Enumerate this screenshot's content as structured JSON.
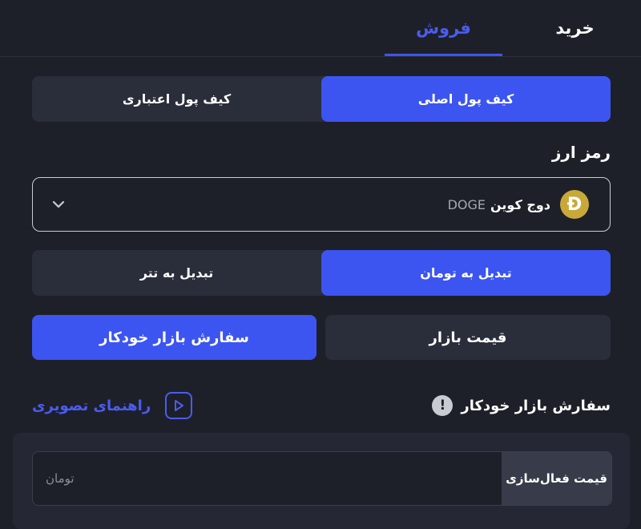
{
  "tabs": {
    "buy": "خرید",
    "sell": "فروش"
  },
  "wallet": {
    "main": "کیف پول اصلی",
    "credit": "کیف پول اعتباری"
  },
  "crypto": {
    "label": "رمز ارز",
    "selected_name": "دوج کوین",
    "selected_symbol": "DOGE",
    "icon_glyph": "Ð"
  },
  "convert": {
    "toman": "تبدیل به تومان",
    "tether": "تبدیل به تتر"
  },
  "order_type": {
    "market": "قیمت بازار",
    "auto": "سفارش بازار خودکار"
  },
  "order_section": {
    "title": "سفارش بازار خودکار",
    "info_glyph": "!",
    "guide": "راهنمای تصویری"
  },
  "price": {
    "label": "قیمت فعال‌سازی",
    "placeholder": "تومان"
  },
  "colors": {
    "accent": "#3c55f0",
    "background": "#1e2029",
    "surface": "#2a2d3a",
    "coin": "#c9a83a"
  }
}
